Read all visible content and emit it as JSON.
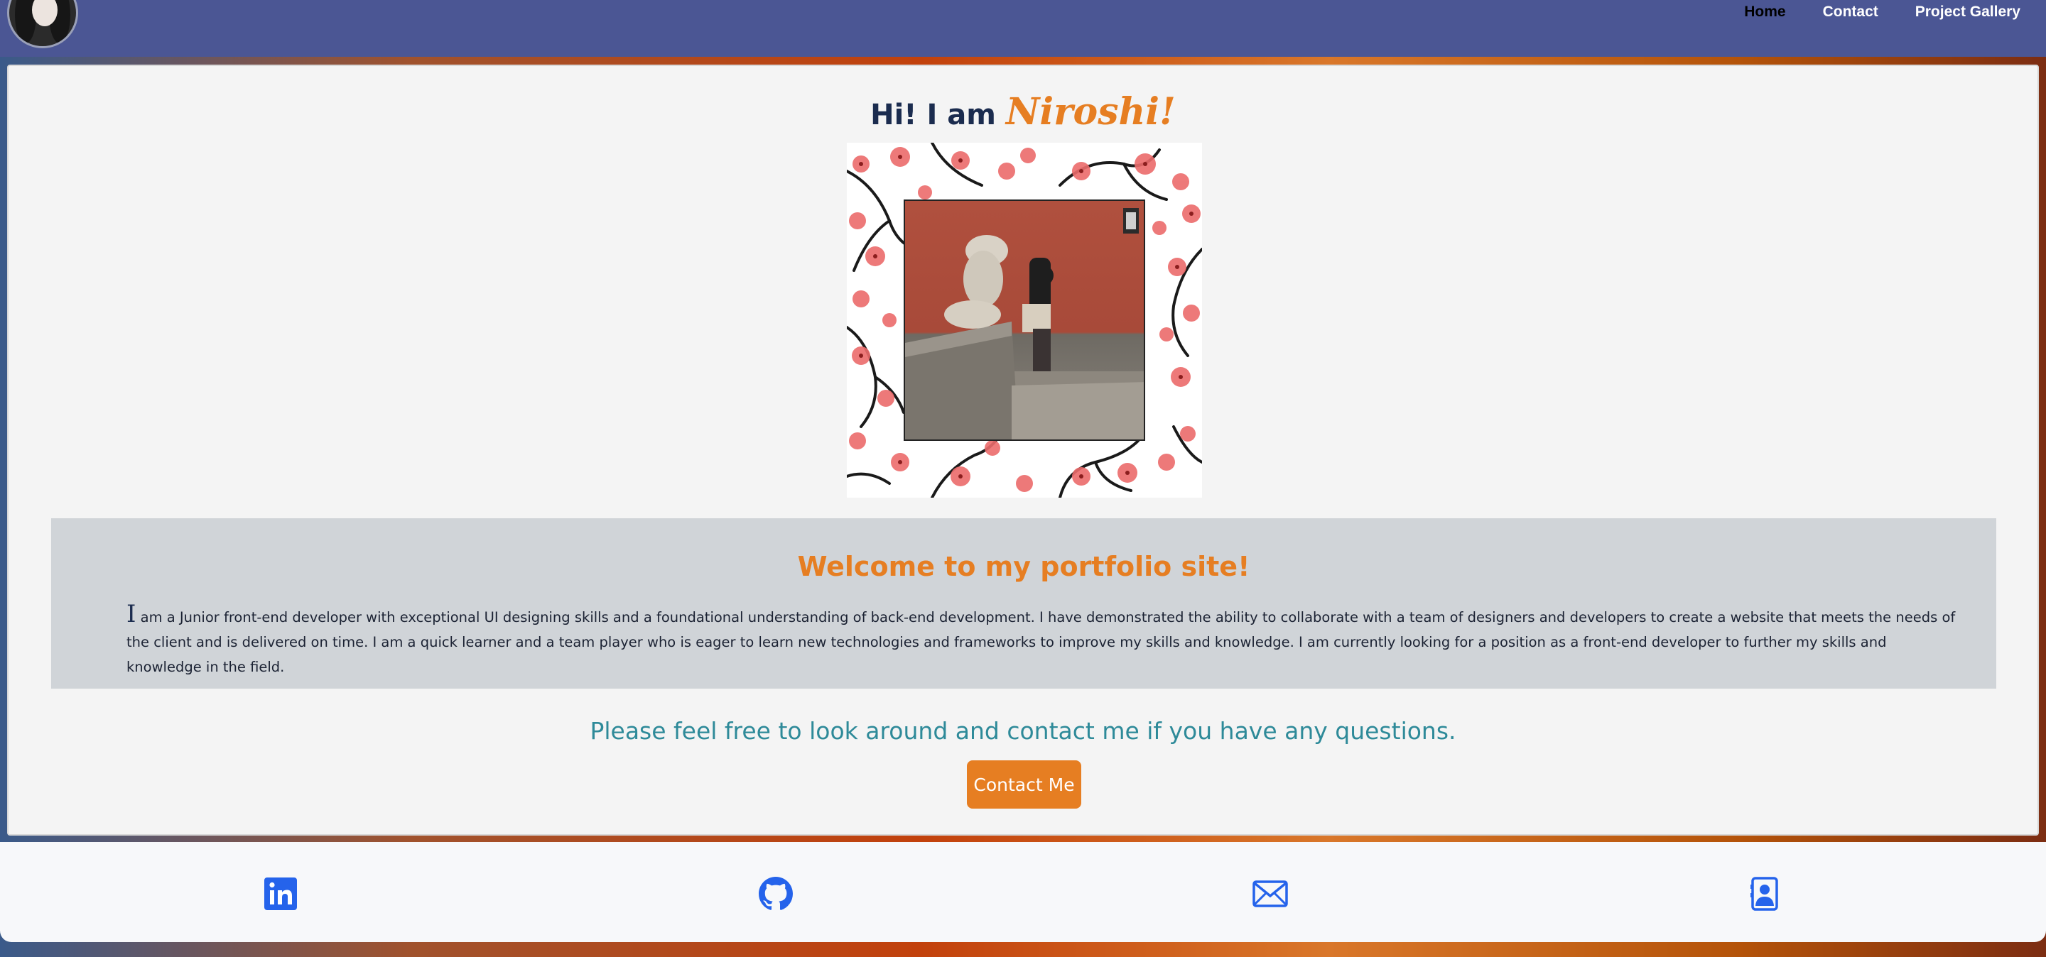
{
  "nav": {
    "links": [
      "Home",
      "Contact",
      "Project Gallery"
    ],
    "active_index": 0
  },
  "hero": {
    "greeting": "Hi! I am ",
    "name": "Niroshi!"
  },
  "welcome": {
    "title": "Welcome to my portfolio site!",
    "dropcap": "I",
    "body": " am a Junior front-end developer with exceptional UI designing skills and a foundational understanding of back-end development. I have demonstrated the ability to collaborate with a team of designers and developers to create a website that meets the needs of the client and is delivered on time. I am a quick learner and a team player who is eager to learn new technologies and frameworks to improve my skills and knowledge. I am currently looking for a position as a front-end developer to further my skills and knowledge in the field."
  },
  "invite": {
    "text": "Please feel free to look around and contact me if you have any questions.",
    "button_label": "Contact Me"
  },
  "footer": {
    "icons": [
      "linkedin-icon",
      "github-icon",
      "mail-icon",
      "contact-card-icon"
    ]
  },
  "colors": {
    "navbar": "#4b5694",
    "accent_orange": "#e67e22",
    "teal": "#2e8a99",
    "icon_blue": "#2563eb",
    "band_gray": "#d0d4d8"
  }
}
